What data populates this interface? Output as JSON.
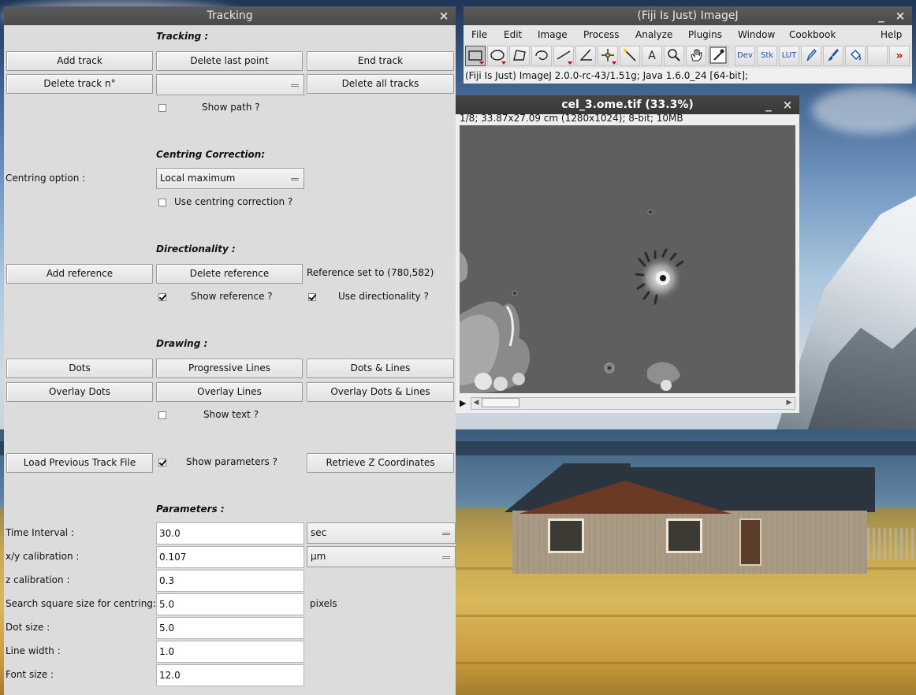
{
  "tracking": {
    "title": "Tracking",
    "close_glyph": "×",
    "sections": {
      "tracking": "Tracking :",
      "centring": "Centring Correction:",
      "directionality": "Directionality :",
      "drawing": "Drawing :",
      "parameters": "Parameters :"
    },
    "buttons": {
      "add_track": "Add track",
      "delete_last_point": "Delete last point",
      "end_track": "End track",
      "delete_track_n": "Delete track n°",
      "delete_all_tracks": "Delete all tracks",
      "add_reference": "Add reference",
      "delete_reference": "Delete reference",
      "dots": "Dots",
      "progressive_lines": "Progressive Lines",
      "dots_lines": "Dots & Lines",
      "overlay_dots": "Overlay Dots",
      "overlay_lines": "Overlay Lines",
      "overlay_dots_lines": "Overlay Dots & Lines",
      "load_previous": "Load Previous Track File",
      "retrieve_z": "Retrieve Z Coordinates"
    },
    "track_select_value": "",
    "checkboxes": {
      "show_path": {
        "label": "Show path ?",
        "checked": false
      },
      "use_centring": {
        "label": "Use centring correction ?",
        "checked": false
      },
      "show_reference": {
        "label": "Show reference ?",
        "checked": true
      },
      "use_directionality": {
        "label": "Use directionality ?",
        "checked": true
      },
      "show_text": {
        "label": "Show text ?",
        "checked": false
      },
      "show_parameters": {
        "label": "Show parameters ?",
        "checked": true
      }
    },
    "centring_option_label": "Centring option :",
    "centring_option_value": "Local maximum",
    "reference_text": "Reference set to (780,582)",
    "params": {
      "time_interval": {
        "label": "Time Interval :",
        "value": "30.0",
        "unit": "sec"
      },
      "xy_calibration": {
        "label": "x/y calibration :",
        "value": "0.107",
        "unit": "µm"
      },
      "z_calibration": {
        "label": "z calibration :",
        "value": "0.3"
      },
      "search_square": {
        "label": "Search square size for centring:",
        "value": "5.0",
        "unit": "pixels"
      },
      "dot_size": {
        "label": "Dot size :",
        "value": "5.0"
      },
      "line_width": {
        "label": "Line width :",
        "value": "1.0"
      },
      "font_size": {
        "label": "Font size :",
        "value": "12.0"
      }
    }
  },
  "imagej": {
    "title": "(Fiji Is Just) ImageJ",
    "minimize_glyph": "_",
    "close_glyph": "×",
    "menu": [
      "File",
      "Edit",
      "Image",
      "Process",
      "Analyze",
      "Plugins",
      "Window",
      "Cookbook",
      "Help"
    ],
    "tools": {
      "dev": "Dev",
      "stk": "Stk",
      "lut": "LUT",
      "text_tool": "A",
      "more": "»"
    },
    "status": "(Fiji Is Just) ImageJ 2.0.0-rc-43/1.51g; Java 1.6.0_24 [64-bit];"
  },
  "image_window": {
    "title": "cel_3.ome.tif (33.3%)",
    "minimize_glyph": "_",
    "close_glyph": "×",
    "info": "1/8; 33.87x27.09 cm (1280x1024); 8-bit; 10MB",
    "play_glyph": "▶",
    "left_arrow": "◀",
    "right_arrow": "▶"
  },
  "colors": {
    "titlebar": "#4a4a4a",
    "window_bg": "#dcdcdc",
    "image_bg": "#5f5f5f",
    "accent_red": "#cc0000",
    "accent_blue": "#1f4fa8"
  }
}
